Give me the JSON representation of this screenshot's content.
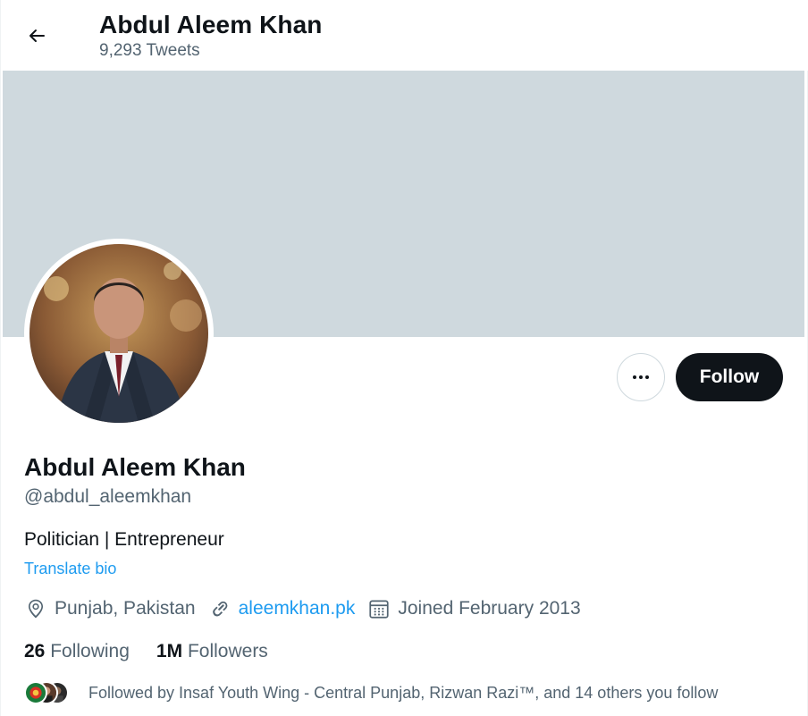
{
  "header": {
    "title": "Abdul Aleem Khan",
    "tweet_count": "9,293 Tweets"
  },
  "profile": {
    "name": "Abdul Aleem Khan",
    "handle": "@abdul_aleemkhan",
    "bio": "Politician | Entrepreneur",
    "translate_label": "Translate bio",
    "location": "Punjab, Pakistan",
    "website": "aleemkhan.pk",
    "joined": "Joined February 2013"
  },
  "actions": {
    "more_icon": "more-horizontal-icon",
    "follow_label": "Follow"
  },
  "stats": {
    "following_count": "26",
    "following_label": "Following",
    "followers_count": "1M",
    "followers_label": "Followers"
  },
  "followed_by": {
    "text": "Followed by Insaf Youth Wing - Central Punjab, Rizwan Razi™, and 14 others you follow"
  },
  "colors": {
    "accent": "#1d9bf0",
    "text_primary": "#0f1419",
    "text_secondary": "#536471",
    "banner": "#cfd9de",
    "follow_bg": "#0f1419"
  }
}
